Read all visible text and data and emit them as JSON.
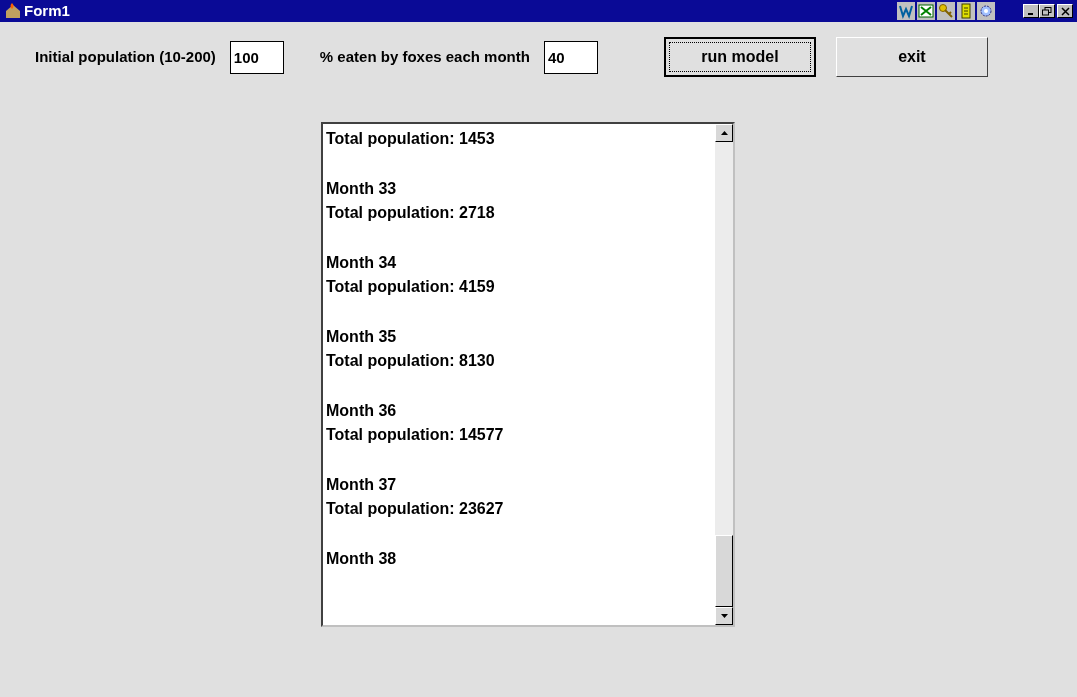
{
  "window": {
    "title": "Form1"
  },
  "inputs": [
    {
      "label": "Initial population (10-200)",
      "value": "100"
    },
    {
      "label": "% eaten by foxes each month",
      "value": "40"
    }
  ],
  "buttons": [
    {
      "label": "run model",
      "focused": true
    },
    {
      "label": "exit",
      "focused": false
    }
  ],
  "output": {
    "blocks": [
      {
        "lines": [
          "Total population: 1453"
        ]
      },
      {
        "lines": [
          "Month 33",
          "Total population: 2718"
        ]
      },
      {
        "lines": [
          "Month 34",
          "Total population: 4159"
        ]
      },
      {
        "lines": [
          "Month 35",
          "Total population: 8130"
        ]
      },
      {
        "lines": [
          "Month 36",
          "Total population: 14577"
        ]
      },
      {
        "lines": [
          "Month 37",
          "Total population: 23627"
        ]
      },
      {
        "lines": [
          "Month 38"
        ]
      }
    ]
  }
}
